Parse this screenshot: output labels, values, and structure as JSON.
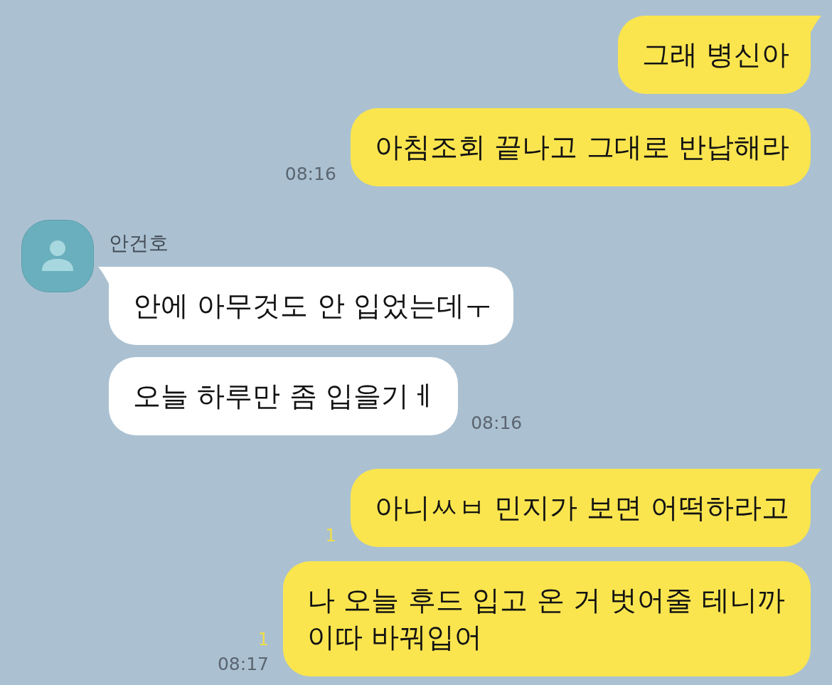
{
  "messages": [
    {
      "kind": "sent",
      "bubbles": [
        {
          "text": "그래 병신아"
        },
        {
          "text": "아침조회 끝나고 그대로 반납해라",
          "time": "08:16"
        }
      ]
    },
    {
      "kind": "received",
      "sender": "안건호",
      "bubbles": [
        {
          "text": "안에 아무것도 안 입었는데ㅜ"
        },
        {
          "text": "오늘 하루만 좀 입을기ㅔ",
          "time": "08:16"
        }
      ]
    },
    {
      "kind": "sent",
      "bubbles": [
        {
          "text": "아니ㅆㅂ 민지가 보면 어떡하라고",
          "unread": "1"
        },
        {
          "text": "나 오늘 후드 입고 온 거 벗어줄 테니까 이따 바꿔입어",
          "unread": "1",
          "time": "08:17"
        }
      ]
    }
  ]
}
